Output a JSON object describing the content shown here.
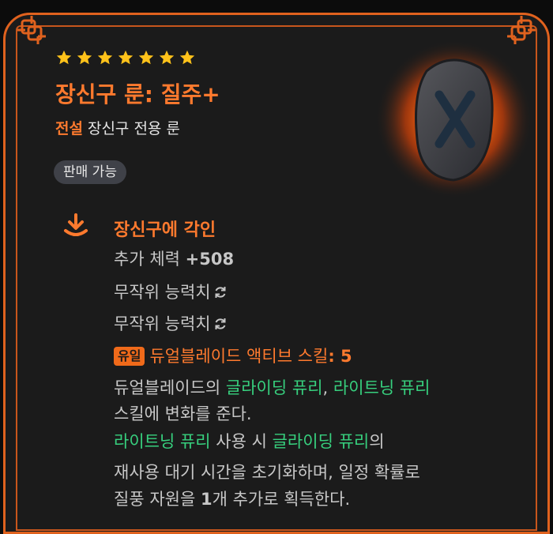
{
  "item": {
    "stars": 7,
    "name": "장신구 룬: 질주+",
    "grade": "전설",
    "type": "장신구 전용 룬",
    "tradeable": "판매 가능"
  },
  "section": {
    "title": "장신구에 각인",
    "stat_label": "추가 체력",
    "stat_value": "+508",
    "random1": "무작위 능력치",
    "random2": "무작위 능력치",
    "unique_tag": "유일",
    "skill_name": "듀얼블레이드 액티브 스킬",
    "skill_value": ": 5",
    "desc": {
      "l1_a": "듀얼블레이드의 ",
      "l1_b": "글라이딩 퓨리",
      "l1_c": ", ",
      "l1_d": "라이트닝 퓨리",
      "l2": "스킬에 변화를 준다.",
      "l3_a": "라이트닝 퓨리",
      "l3_b": " 사용 시 ",
      "l3_c": "글라이딩 퓨리",
      "l3_d": "의",
      "l4": "재사용 대기 시간을 초기화하며, 일정 확률로",
      "l5_a": "질풍 자원을 ",
      "l5_b": "1",
      "l5_c": "개 추가로 획득한다."
    }
  },
  "colors": {
    "accent": "#ff7a2e",
    "border": "#e0621e",
    "skill_name": "#37d07e",
    "panel_bg": "#1b1b1b",
    "star": "#ffc21a"
  },
  "icons": {
    "stars": "star-icon",
    "section": "engrave-down-arrow-icon",
    "refresh": "refresh-icon",
    "rune": "rune-stone-icon"
  }
}
